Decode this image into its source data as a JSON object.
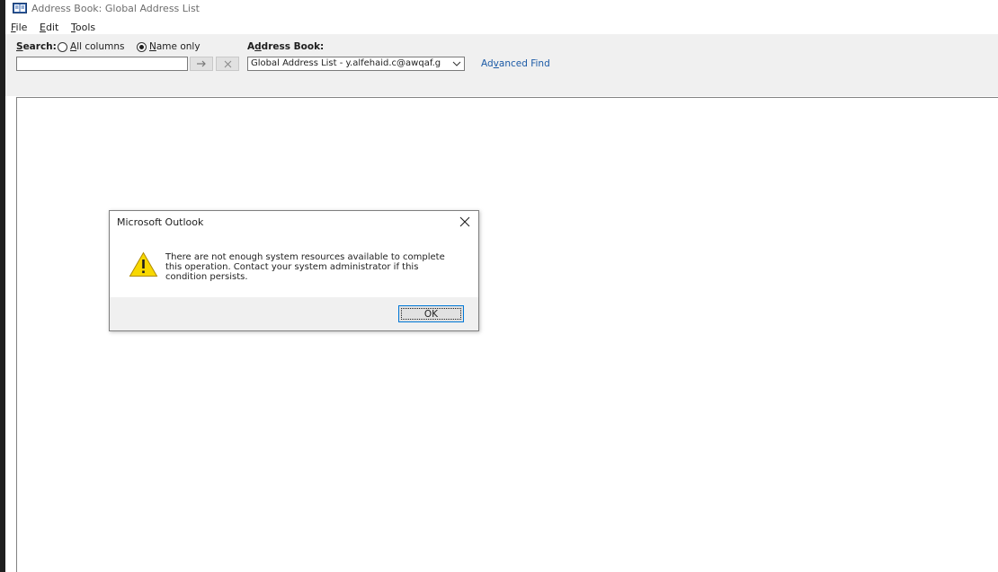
{
  "window": {
    "title": "Address Book: Global Address List",
    "icon": "address-book-icon"
  },
  "menu": {
    "items": [
      {
        "mnemonic": "F",
        "rest": "ile"
      },
      {
        "mnemonic": "E",
        "rest": "dit"
      },
      {
        "mnemonic": "T",
        "rest": "ools"
      }
    ]
  },
  "search": {
    "label_mnemonic": "S",
    "label_rest": "earch:",
    "value": "",
    "options": [
      {
        "mnemonic": "A",
        "rest": "ll columns",
        "selected": false
      },
      {
        "mnemonic": "N",
        "rest": "ame only",
        "selected": true
      }
    ],
    "go_icon": "arrow-right-icon",
    "clear_icon": "close-icon"
  },
  "address_book": {
    "label_pre": "A",
    "label_mnemonic": "d",
    "label_rest": "dress Book:",
    "selected": "Global Address List - y.alfehaid.c@awqaf.g",
    "chevron_icon": "chevron-down-icon"
  },
  "advanced_find": {
    "pre": "Ad",
    "mnemonic": "v",
    "rest": "anced Find",
    "color": "#1b5aa6"
  },
  "dialog": {
    "title": "Microsoft Outlook",
    "message": "There are not enough system resources available to complete this operation. Contact your system administrator if this condition persists.",
    "ok_label": "OK",
    "icon": "warning-icon",
    "close_icon": "close-icon"
  }
}
